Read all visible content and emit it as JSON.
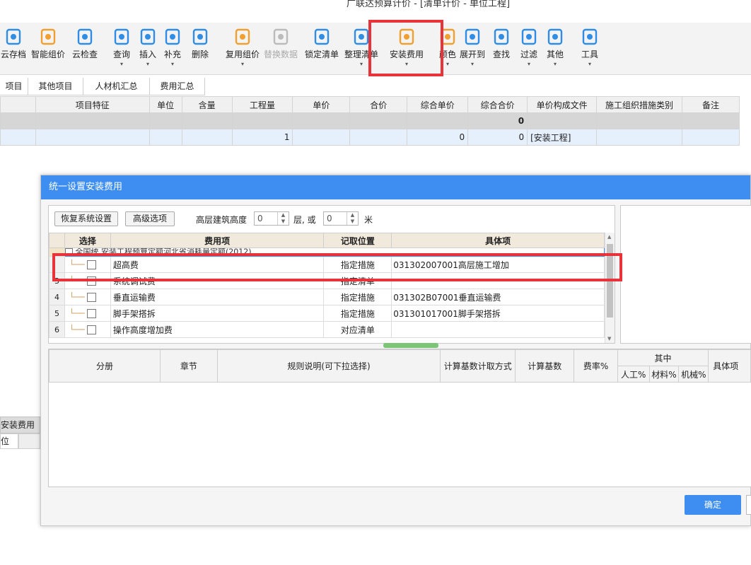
{
  "window": {
    "title": "广联达预算计价 - [清单计价 - 单位工程]"
  },
  "ribbon": {
    "items": [
      {
        "label": "云存档",
        "icon": "cloud-upload-icon",
        "dropdown": false
      },
      {
        "label": "智能组价",
        "icon": "smart-price-icon",
        "dropdown": false
      },
      {
        "label": "云检查",
        "icon": "cloud-check-icon",
        "dropdown": false
      },
      {
        "label": "查询",
        "icon": "query-icon",
        "dropdown": true
      },
      {
        "label": "插入",
        "icon": "insert-icon",
        "dropdown": true
      },
      {
        "label": "补充",
        "icon": "supplement-icon",
        "dropdown": true
      },
      {
        "label": "删除",
        "icon": "delete-icon",
        "dropdown": false
      },
      {
        "label": "复用组价",
        "icon": "reuse-price-icon",
        "dropdown": true
      },
      {
        "label": "替换数据",
        "icon": "replace-data-icon",
        "dropdown": false,
        "disabled": true
      },
      {
        "label": "锁定清单",
        "icon": "lock-icon",
        "dropdown": false
      },
      {
        "label": "整理清单",
        "icon": "organize-list-icon",
        "dropdown": true
      },
      {
        "label": "安装费用",
        "icon": "install-fee-icon",
        "dropdown": true
      },
      {
        "label": "颜色",
        "icon": "color-icon",
        "dropdown": true
      },
      {
        "label": "展开到",
        "icon": "expand-to-icon",
        "dropdown": true
      },
      {
        "label": "查找",
        "icon": "binoculars-icon",
        "dropdown": false
      },
      {
        "label": "过滤",
        "icon": "filter-icon",
        "dropdown": true
      },
      {
        "label": "其他",
        "icon": "other-grid-icon",
        "dropdown": true
      },
      {
        "label": "工具",
        "icon": "tools-icon",
        "dropdown": true
      }
    ],
    "dropdown_glyph": "▾"
  },
  "tabs": [
    "项目",
    "其他项目",
    "人材机汇总",
    "费用汇总"
  ],
  "grid": {
    "headers": [
      "",
      "项目特征",
      "单位",
      "含量",
      "工程量",
      "单价",
      "合价",
      "综合单价",
      "综合合价",
      "单价构成文件",
      "施工组织措施类别",
      "备注"
    ],
    "rows": [
      [
        "",
        "",
        "",
        "",
        "",
        "",
        "",
        "",
        "0",
        "",
        "",
        ""
      ],
      [
        "",
        "",
        "",
        "",
        "1",
        "",
        "",
        "0",
        "0",
        "[安装工程]",
        "",
        ""
      ]
    ]
  },
  "left_panel": {
    "title": "安装费用",
    "col": "位"
  },
  "dialog": {
    "title": "统一设置安装费用",
    "restore_button": "恢复系统设置",
    "advanced_button": "高级选项",
    "height_label": "高层建筑高度",
    "height_value": "0",
    "floor_unit": "层, 或",
    "meter_value": "0",
    "meter_unit": "米",
    "fee_table": {
      "headers": [
        "选择",
        "费用项",
        "记取位置",
        "具体项"
      ],
      "group_row": {
        "check_label": "全国统",
        "name": "安装工程预算定额河北省消耗量定额(2012)"
      },
      "rows": [
        {
          "index": "",
          "name": "超高费",
          "position": "指定措施",
          "detail": "031302007001高层施工增加"
        },
        {
          "index": "3",
          "name": "系统调试费",
          "position": "指定清单",
          "detail": ""
        },
        {
          "index": "4",
          "name": "垂直运输费",
          "position": "指定措施",
          "detail": "031302B07001垂直运输费"
        },
        {
          "index": "5",
          "name": "脚手架搭拆",
          "position": "指定措施",
          "detail": "031301017001脚手架搭拆"
        },
        {
          "index": "6",
          "name": "操作高度增加费",
          "position": "对应清单",
          "detail": ""
        }
      ]
    },
    "detail_table": {
      "headers": [
        "分册",
        "章节",
        "规则说明(可下拉选择)",
        "计算基数计取方式",
        "计算基数",
        "费率%",
        "其中",
        "具体项"
      ],
      "sub_headers": [
        "人工%",
        "材料%",
        "机械%"
      ]
    },
    "ok_button": "确定"
  }
}
